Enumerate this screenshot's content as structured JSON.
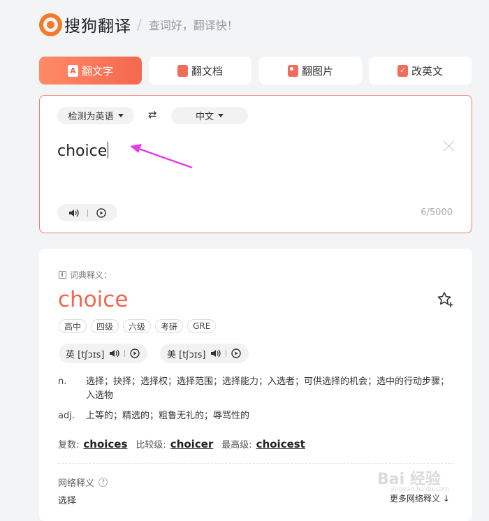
{
  "header": {
    "brand": "搜狗翻译",
    "separator": "/",
    "slogan": "查词好，翻译快！"
  },
  "tabs": [
    {
      "label": "翻文字",
      "icon": "text-icon",
      "active": true
    },
    {
      "label": "翻文档",
      "icon": "document-icon",
      "active": false
    },
    {
      "label": "翻图片",
      "icon": "image-icon",
      "active": false
    },
    {
      "label": "改英文",
      "icon": "edit-english-icon",
      "active": false
    }
  ],
  "input": {
    "source_lang": "检测为英语",
    "target_lang": "中文",
    "swap_symbol": "⇄",
    "text": "choice",
    "counter": "6/5000"
  },
  "result": {
    "dict_label": "词典释义：",
    "headword": "choice",
    "tags": [
      "高中",
      "四级",
      "六级",
      "考研",
      "GRE"
    ],
    "phonetic_uk": "英 [tʃɔɪs]",
    "phonetic_us": "美 [tʃɔɪs]",
    "definitions": [
      {
        "pos": "n.",
        "meaning": "选择；抉择；选择权；选择范围；选择能力；入选者；可供选择的机会；选中的行动步骤；入选物"
      },
      {
        "pos": "adj.",
        "meaning": "上等的；精选的；粗鲁无礼的；辱骂性的"
      }
    ],
    "forms": {
      "plural_label": "复数:",
      "plural": "choices",
      "comparative_label": "比较级:",
      "comparative": "choicer",
      "superlative_label": "最高级:",
      "superlative": "choicest"
    },
    "net_label": "网络释义",
    "net_value": "选择",
    "more_link": "更多网络释义 ↓"
  },
  "watermark": {
    "text": "Bai 经验",
    "sub": "jingyan.baidu.com"
  },
  "colors": {
    "accent": "#f0664f",
    "logo": "#f47a2a",
    "arrow": "#e43de6"
  }
}
